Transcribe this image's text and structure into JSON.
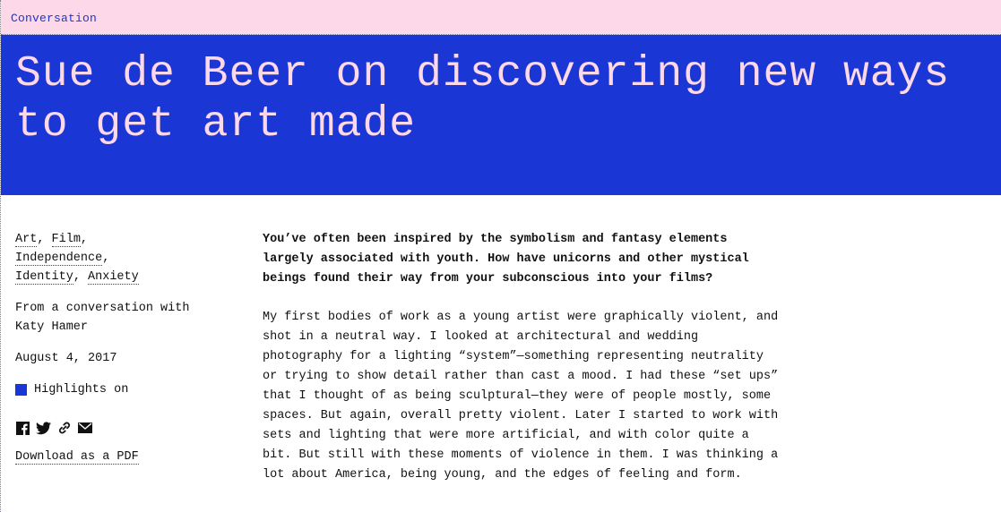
{
  "header": {
    "section_label": "Conversation"
  },
  "hero": {
    "title": "Sue de Beer on discovering new ways to get art made"
  },
  "sidebar": {
    "tags": [
      "Art",
      "Film",
      "Independence",
      "Identity",
      "Anxiety"
    ],
    "byline": "From a conversation with Katy Hamer",
    "date": "August 4, 2017",
    "highlights_label": "Highlights on",
    "download_label": "Download as a PDF",
    "share_icons": [
      "facebook-icon",
      "twitter-icon",
      "link-icon",
      "email-icon"
    ]
  },
  "article": {
    "question": "You’ve often been inspired by the symbolism and fantasy elements largely associated with youth. How have unicorns and other mystical beings found their way from your subconscious into your films?",
    "answer": "My first bodies of work as a young artist were graphically violent, and shot in a neutral way. I looked at architectural and wedding photography for a lighting “system”—something representing neutrality or trying to show detail rather than cast a mood. I had these “set ups” that I thought of as being sculptural—they were of people mostly, some spaces. But again, overall pretty violent. Later I started to work with sets and lighting that were more artificial, and with color quite a bit. But still with these moments of violence in them. I was thinking a lot about America, being young, and the edges of feeling and form."
  },
  "colors": {
    "accent_blue": "#1a36d4",
    "pink": "#fcd8e8"
  }
}
